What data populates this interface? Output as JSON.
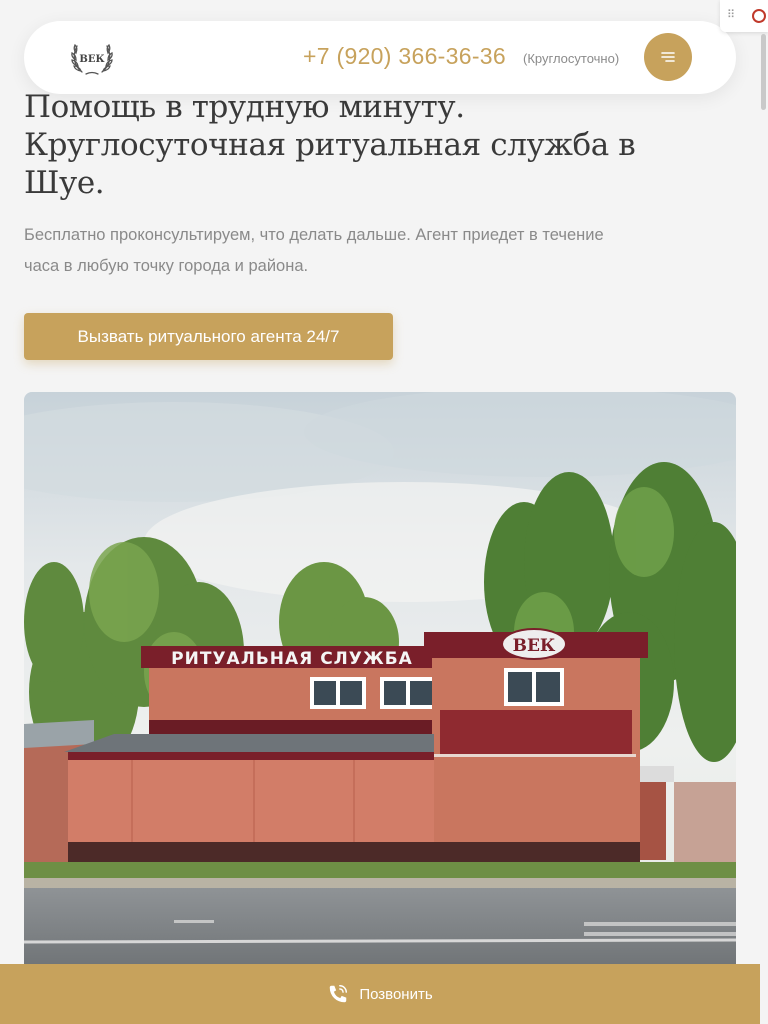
{
  "header": {
    "logo_text": "ВЕК",
    "phone": "+7 (920) 366-36-36",
    "phone_note": "(Круглосуточно)",
    "menu_icon": "menu-lines-icon"
  },
  "hero": {
    "title": "Помощь в трудную минуту. Круглосуточная ритуальная служба в Шуе.",
    "subtitle": "Бесплатно проконсультируем, что делать дальше. Агент приедет в течение часа в любую точку города и района.",
    "cta_label": "Вызвать ритуального агента 24/7"
  },
  "photo": {
    "sign_text": "РИТУАЛЬНАЯ СЛУЖБА",
    "brand_sign": "ВЕК"
  },
  "bottom_bar": {
    "icon": "phone-call-icon",
    "label": "Позвонить"
  },
  "colors": {
    "accent": "#c7a25c",
    "background": "#f4f4f4",
    "text": "#3a3a3a",
    "muted": "#8a8a8a"
  }
}
